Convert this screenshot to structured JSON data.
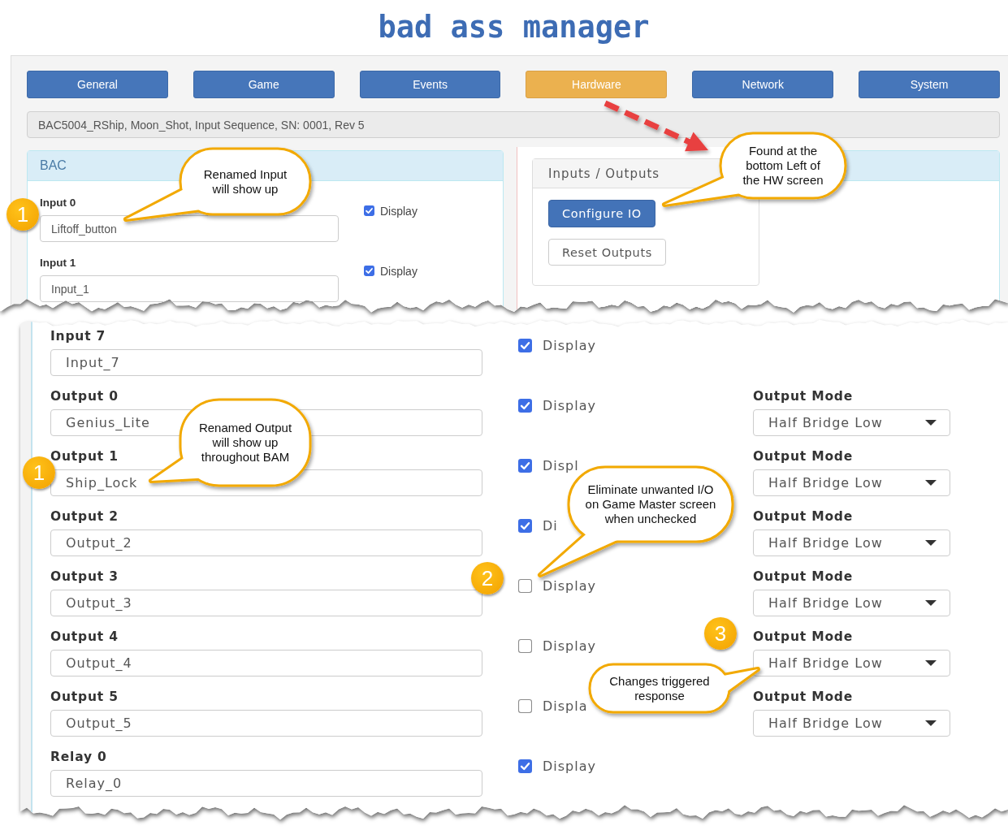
{
  "header": {
    "title": "bad ass manager"
  },
  "tabs": [
    {
      "label": "General",
      "selected": false
    },
    {
      "label": "Game",
      "selected": false
    },
    {
      "label": "Events",
      "selected": false
    },
    {
      "label": "Hardware",
      "selected": true
    },
    {
      "label": "Network",
      "selected": false
    },
    {
      "label": "System",
      "selected": false
    }
  ],
  "info_bar": {
    "text": "BAC5004_RShip, Moon_Shot, Input Sequence, SN: 0001, Rev 5"
  },
  "bac_panel": {
    "title": "BAC",
    "rows": [
      {
        "label": "Input 0",
        "value": "Liftoff_button",
        "display": {
          "label": "Display",
          "checked": true
        }
      },
      {
        "label": "Input 1",
        "value": "Input_1",
        "display": {
          "label": "Display",
          "checked": true
        }
      }
    ]
  },
  "io_panel": {
    "title": "Inputs / Outputs",
    "buttons": [
      {
        "label": "Configure IO",
        "kind": "primary"
      },
      {
        "label": "Reset Outputs",
        "kind": "default"
      }
    ]
  },
  "io_rows": [
    {
      "label": "Input 7",
      "value": "Input_7",
      "display": {
        "label": "Display",
        "checked": true
      }
    },
    {
      "label": "Output 0",
      "value": "Genius_Lite",
      "display": {
        "label": "Display",
        "checked": true
      },
      "mode": {
        "label": "Output Mode",
        "value": "Half Bridge Low"
      }
    },
    {
      "label": "Output 1",
      "value": "Ship_Lock",
      "display": {
        "label": "Displ",
        "checked": true
      },
      "mode": {
        "label": "Output Mode",
        "value": "Half Bridge Low"
      }
    },
    {
      "label": "Output 2",
      "value": "Output_2",
      "display": {
        "label": "Di",
        "checked": true
      },
      "mode": {
        "label": "Output Mode",
        "value": "Half Bridge Low"
      }
    },
    {
      "label": "Output 3",
      "value": "Output_3",
      "display": {
        "label": "Display",
        "checked": false
      },
      "mode": {
        "label": "Output Mode",
        "value": "Half Bridge Low"
      }
    },
    {
      "label": "Output 4",
      "value": "Output_4",
      "display": {
        "label": "Display",
        "checked": false
      },
      "mode": {
        "label": "Output Mode",
        "value": "Half Bridge Low"
      }
    },
    {
      "label": "Output 5",
      "value": "Output_5",
      "display": {
        "label": "Displa",
        "checked": false
      },
      "mode": {
        "label": "Output Mode",
        "value": "Half Bridge Low"
      }
    },
    {
      "label": "Relay 0",
      "value": "Relay_0",
      "display": {
        "label": "Display",
        "checked": true
      }
    }
  ],
  "callouts": [
    {
      "text": "Renamed Input\nwill show up"
    },
    {
      "text": "Found at the\nbottom Left of\nthe HW screen"
    },
    {
      "text": "Renamed Output\nwill show up\nthroughout BAM"
    },
    {
      "text": "Eliminate unwanted I/O\non Game Master screen\nwhen unchecked"
    },
    {
      "text": "Changes triggered\nresponse"
    }
  ],
  "step_badges": [
    {
      "number": "1"
    },
    {
      "number": "1"
    },
    {
      "number": "2"
    },
    {
      "number": "3"
    }
  ]
}
